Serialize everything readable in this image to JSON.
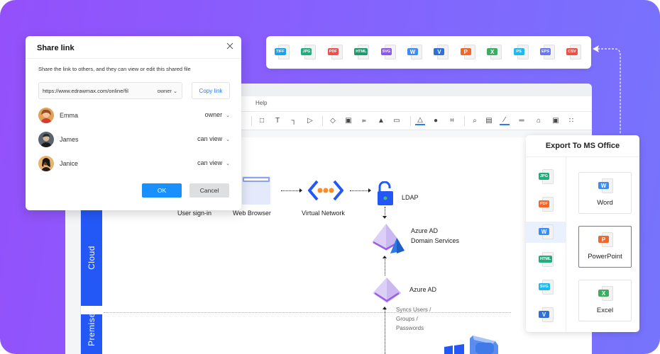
{
  "colors": {
    "accent_blue": "#1890ff",
    "lane_blue": "#2458f6",
    "link_blue": "#2b7cf2",
    "bg_gradient_start": "#9450fb",
    "bg_gradient_end": "#7674fd"
  },
  "share_dialog": {
    "title": "Share link",
    "description": "Share the link to others, and they can view or edit this shared file",
    "link_url": "https://www.edrawmax.com/online/fil",
    "link_permission": "owner",
    "copy_link_label": "Copy link",
    "users": [
      {
        "name": "Emma",
        "role": "owner"
      },
      {
        "name": "James",
        "role": "can view"
      },
      {
        "name": "Janice",
        "role": "can view"
      }
    ],
    "ok_label": "OK",
    "cancel_label": "Cancel",
    "close_icon": "close-icon"
  },
  "format_bar": {
    "formats": [
      {
        "label": "TIFF",
        "color": "#1aa1f0"
      },
      {
        "label": "JPG",
        "color": "#1fae7c"
      },
      {
        "label": "PDF",
        "color": "#ef4e4e"
      },
      {
        "label": "HTML",
        "color": "#1f9a6e"
      },
      {
        "label": "SVG",
        "color": "#8a5ae6"
      },
      {
        "label": "W",
        "color": "#3b8cf5"
      },
      {
        "label": "V",
        "color": "#2f6fd8"
      },
      {
        "label": "P",
        "color": "#f0662b"
      },
      {
        "label": "X",
        "color": "#3dac63"
      },
      {
        "label": "PS",
        "color": "#1fb8ef"
      },
      {
        "label": "EPS",
        "color": "#6a78ec"
      },
      {
        "label": "CSV",
        "color": "#e8524a"
      }
    ]
  },
  "editor": {
    "menu": {
      "help": "Help"
    },
    "toolbar_icons": [
      "rectangle-icon",
      "text-icon",
      "connector-icon",
      "pointer-icon",
      "layers-icon",
      "group-icon",
      "align-icon",
      "flip-icon",
      "frame-icon",
      "fill-icon",
      "shape-style-icon",
      "crop-icon",
      "search-icon",
      "zoom-fit-icon",
      "line-color-icon",
      "line-style-icon",
      "lock-icon",
      "fullscreen-icon",
      "more-icon"
    ],
    "diagram": {
      "lanes": {
        "cloud": "Cloud",
        "premises": "Premises"
      },
      "nodes": {
        "user_signin": "User sign-in",
        "web_browser": "Web Browser",
        "virtual_network": "Virtual Network",
        "ldap": "LDAP",
        "azure_ad_ds_line1": "Azure AD",
        "azure_ad_ds_line2": "Domain Services",
        "azure_ad": "Azure AD",
        "sync_line1": "Syncs Users /",
        "sync_line2": "Groups /",
        "sync_line3": "Passwords"
      }
    }
  },
  "export_panel": {
    "title": "Export To MS Office",
    "side_formats": [
      {
        "label": "JPG",
        "color": "#1fae7c",
        "active": false
      },
      {
        "label": "PDF",
        "color": "#f0662b",
        "active": false
      },
      {
        "label": "W",
        "color": "#3b8cf5",
        "active": true
      },
      {
        "label": "HTML",
        "color": "#1fae7c",
        "active": false
      },
      {
        "label": "SVG",
        "color": "#1fb8ef",
        "active": false
      },
      {
        "label": "V",
        "color": "#2f6fd8",
        "active": false
      }
    ],
    "cards": [
      {
        "label": "Word",
        "badge": "W",
        "color": "#3b8cf5",
        "selected": false
      },
      {
        "label": "PowerPoint",
        "badge": "P",
        "color": "#f0662b",
        "selected": true
      },
      {
        "label": "Excel",
        "badge": "X",
        "color": "#3dac63",
        "selected": false
      }
    ]
  }
}
